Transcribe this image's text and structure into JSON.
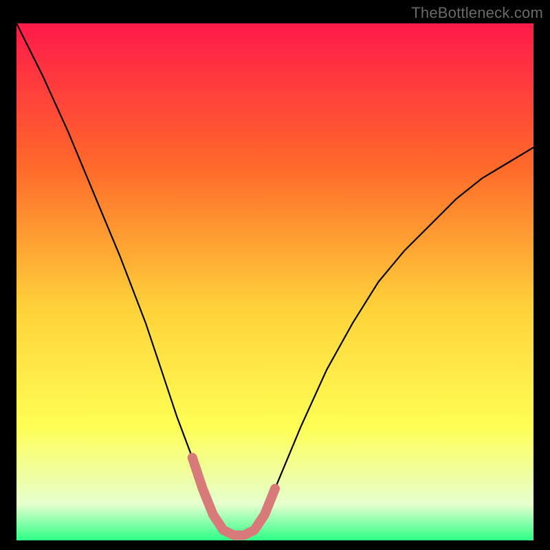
{
  "watermark": "TheBottleneck.com",
  "colors": {
    "bg": "#000000",
    "gradient_top": "#ff1a4a",
    "gradient_mid1": "#ff6a2a",
    "gradient_mid2": "#ffd23a",
    "gradient_mid3": "#ffff55",
    "gradient_near_bottom": "#e6ffcf",
    "gradient_bottom": "#2cff86",
    "curve": "#000000",
    "floor_band": "#d97a7a"
  },
  "chart_data": {
    "type": "line",
    "title": "",
    "xlabel": "",
    "ylabel": "",
    "xlim": [
      0,
      100
    ],
    "ylim": [
      0,
      100
    ],
    "series": [
      {
        "name": "bottleneck-curve",
        "x": [
          0,
          5,
          10,
          15,
          20,
          25,
          28,
          31,
          34,
          36,
          38,
          40,
          42,
          44,
          46,
          48,
          50,
          55,
          60,
          65,
          70,
          75,
          80,
          85,
          90,
          95,
          100
        ],
        "y": [
          100,
          90,
          79,
          67,
          55,
          42,
          33,
          24,
          16,
          10,
          5,
          2,
          1,
          1,
          2,
          5,
          10,
          22,
          33,
          42,
          50,
          56,
          61,
          66,
          70,
          73,
          76
        ]
      }
    ],
    "highlight": {
      "name": "floor-band",
      "x": [
        34,
        36,
        38,
        40,
        42,
        44,
        46,
        48,
        50
      ],
      "y": [
        16,
        10,
        5,
        2,
        1,
        1,
        2,
        5,
        10
      ]
    }
  }
}
